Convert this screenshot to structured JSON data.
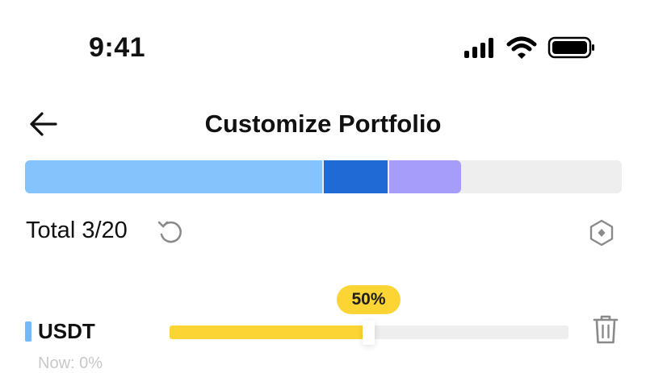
{
  "status_bar": {
    "time": "9:41"
  },
  "header": {
    "title": "Customize Portfolio",
    "back_icon": "arrow-left-icon"
  },
  "allocation_bar": {
    "segments": [
      {
        "color": "#84c3fb",
        "share": 0.5
      },
      {
        "color": "#1f6ad4",
        "share": 0.11
      },
      {
        "color": "#a69cf9",
        "share": 0.12
      }
    ],
    "remaining_color": "#eeeeee"
  },
  "summary": {
    "total_label": "Total 3/20",
    "reset_icon": "refresh-icon",
    "settings_icon": "settings-hexagon-icon"
  },
  "assets": [
    {
      "name": "USDT",
      "allocation_label": "50%",
      "allocation": 0.5,
      "color": "#74b9f7",
      "subtext": "Now: 0%"
    }
  ]
}
